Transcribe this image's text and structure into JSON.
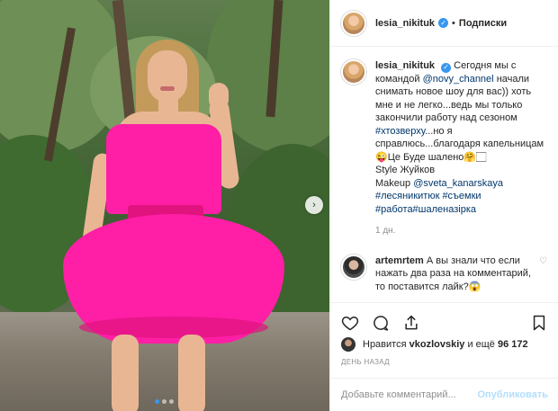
{
  "post": {
    "username": "lesia_nikituk",
    "follow_label": "Подписки",
    "separator": "•"
  },
  "caption": {
    "username": "lesia_nikituk",
    "lines": [
      "Сегодня мы с",
      "командой",
      "@novy_channel",
      "начали снимать новое шоу для вас)) хоть мне и не легко...ведь мы только закончили работу над сезоном",
      "#хтозверху",
      "...но я справлюсь...благодаря капельницам",
      "😜Це Буде шалено🤗🏻",
      "Style Жуйков",
      "Makeup",
      "@sveta_kanarskaya",
      "#лесяникитюк #съемки",
      "#работа#шаленазірка"
    ],
    "time": "1 дн."
  },
  "comment": {
    "username": "artemrtem",
    "text": "А вы знали что если нажать два раза на комментарий, то поставится лайк?😱"
  },
  "likes": {
    "prefix": "Нравится",
    "user": "vkozlovskiy",
    "middle": "и ещё",
    "count": "96 172"
  },
  "posted_ago": "ДЕНЬ НАЗАД",
  "add_comment": {
    "placeholder": "Добавьте комментарий...",
    "publish_label": "Опубликовать"
  },
  "carousel": {
    "next_glyph": "›",
    "slides": 3,
    "active_index": 0
  },
  "colors": {
    "dress": "#ff1fa6",
    "link": "#00376b",
    "verified": "#3897f0",
    "muted": "#8e8e8e"
  }
}
